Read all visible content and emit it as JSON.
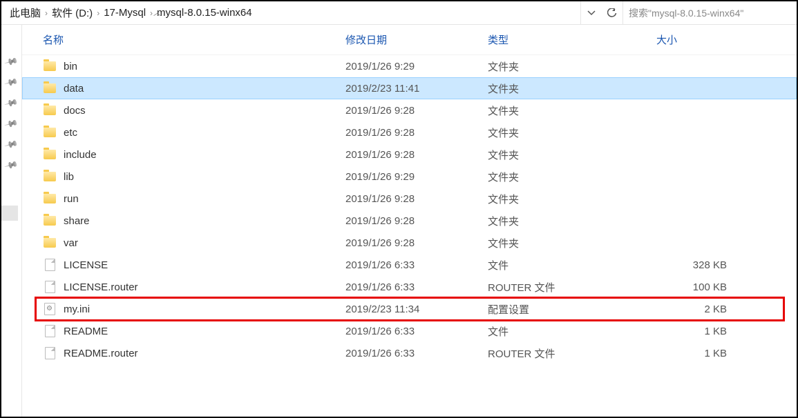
{
  "breadcrumb": {
    "items": [
      "此电脑",
      "软件 (D:)",
      "17-Mysql",
      "mysql-8.0.15-winx64"
    ]
  },
  "search": {
    "placeholder": "搜索\"mysql-8.0.15-winx64\""
  },
  "columns": {
    "name": "名称",
    "date": "修改日期",
    "type": "类型",
    "size": "大小"
  },
  "files": [
    {
      "name": "bin",
      "date": "2019/1/26 9:29",
      "type": "文件夹",
      "size": "",
      "icon": "folder",
      "selected": false
    },
    {
      "name": "data",
      "date": "2019/2/23 11:41",
      "type": "文件夹",
      "size": "",
      "icon": "folder",
      "selected": true
    },
    {
      "name": "docs",
      "date": "2019/1/26 9:28",
      "type": "文件夹",
      "size": "",
      "icon": "folder",
      "selected": false
    },
    {
      "name": "etc",
      "date": "2019/1/26 9:28",
      "type": "文件夹",
      "size": "",
      "icon": "folder",
      "selected": false
    },
    {
      "name": "include",
      "date": "2019/1/26 9:28",
      "type": "文件夹",
      "size": "",
      "icon": "folder",
      "selected": false
    },
    {
      "name": "lib",
      "date": "2019/1/26 9:29",
      "type": "文件夹",
      "size": "",
      "icon": "folder",
      "selected": false
    },
    {
      "name": "run",
      "date": "2019/1/26 9:28",
      "type": "文件夹",
      "size": "",
      "icon": "folder",
      "selected": false
    },
    {
      "name": "share",
      "date": "2019/1/26 9:28",
      "type": "文件夹",
      "size": "",
      "icon": "folder",
      "selected": false
    },
    {
      "name": "var",
      "date": "2019/1/26 9:28",
      "type": "文件夹",
      "size": "",
      "icon": "folder",
      "selected": false
    },
    {
      "name": "LICENSE",
      "date": "2019/1/26 6:33",
      "type": "文件",
      "size": "328 KB",
      "icon": "file",
      "selected": false
    },
    {
      "name": "LICENSE.router",
      "date": "2019/1/26 6:33",
      "type": "ROUTER 文件",
      "size": "100 KB",
      "icon": "file",
      "selected": false
    },
    {
      "name": "my.ini",
      "date": "2019/2/23 11:34",
      "type": "配置设置",
      "size": "2 KB",
      "icon": "ini",
      "selected": false,
      "highlighted": true
    },
    {
      "name": "README",
      "date": "2019/1/26 6:33",
      "type": "文件",
      "size": "1 KB",
      "icon": "file",
      "selected": false
    },
    {
      "name": "README.router",
      "date": "2019/1/26 6:33",
      "type": "ROUTER 文件",
      "size": "1 KB",
      "icon": "file",
      "selected": false
    }
  ],
  "pins_count": 6
}
